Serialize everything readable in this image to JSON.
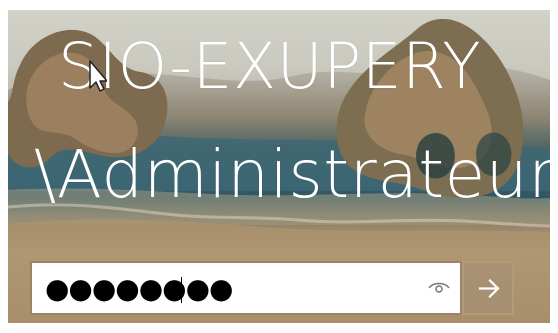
{
  "login": {
    "computer_name": "SIO-EXUPERY",
    "user_name": "\\Administrateur",
    "password_masked": "●●●●●●●●"
  },
  "icons": {
    "reveal_password": "eye-icon",
    "submit": "arrow-right-icon",
    "pointer": "mouse-pointer-icon"
  },
  "colors": {
    "title_text": "#ffffff",
    "password_box": "#ffffff",
    "submit_button": "#a59174"
  }
}
